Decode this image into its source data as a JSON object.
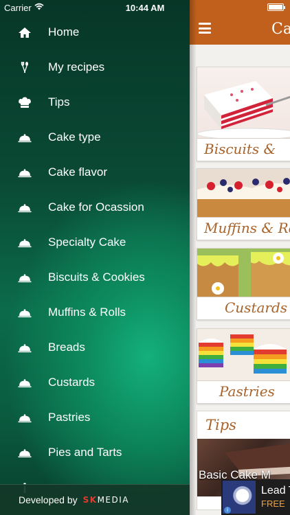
{
  "status": {
    "carrier": "Carrier",
    "time": "10:44 AM"
  },
  "drawer": {
    "items": [
      {
        "label": "Home",
        "icon": "home-icon"
      },
      {
        "label": "My recipes",
        "icon": "fork-spoon-icon"
      },
      {
        "label": "Tips",
        "icon": "chef-hat-icon"
      },
      {
        "label": "Cake type",
        "icon": "cloche-icon"
      },
      {
        "label": "Cake flavor",
        "icon": "cloche-icon"
      },
      {
        "label": "Cake for Ocassion",
        "icon": "cloche-icon"
      },
      {
        "label": "Specialty Cake",
        "icon": "cloche-icon"
      },
      {
        "label": "Biscuits & Cookies",
        "icon": "cloche-icon"
      },
      {
        "label": "Muffins & Rolls",
        "icon": "cloche-icon"
      },
      {
        "label": "Breads",
        "icon": "cloche-icon"
      },
      {
        "label": "Custards",
        "icon": "cloche-icon"
      },
      {
        "label": "Pastries",
        "icon": "cloche-icon"
      },
      {
        "label": "Pies and Tarts",
        "icon": "cloche-icon"
      }
    ],
    "footer": {
      "developed_by": "Developed by",
      "brand_first": "SK",
      "brand_rest": "MEDIA"
    }
  },
  "main": {
    "nav_title": "Ca",
    "cards": [
      {
        "caption": "Biscuits &"
      },
      {
        "caption": "Muffins & Ro"
      },
      {
        "caption": "Custards"
      },
      {
        "caption": "Pastries"
      }
    ],
    "tips": {
      "title": "Tips",
      "caption": "Basic Cake M"
    }
  },
  "ad": {
    "title": "Lead T",
    "subtitle": "FREE"
  },
  "colors": {
    "navbar": "#c0601c",
    "caption_text": "#a8632b",
    "drawer_green": "#0d8a5e"
  }
}
